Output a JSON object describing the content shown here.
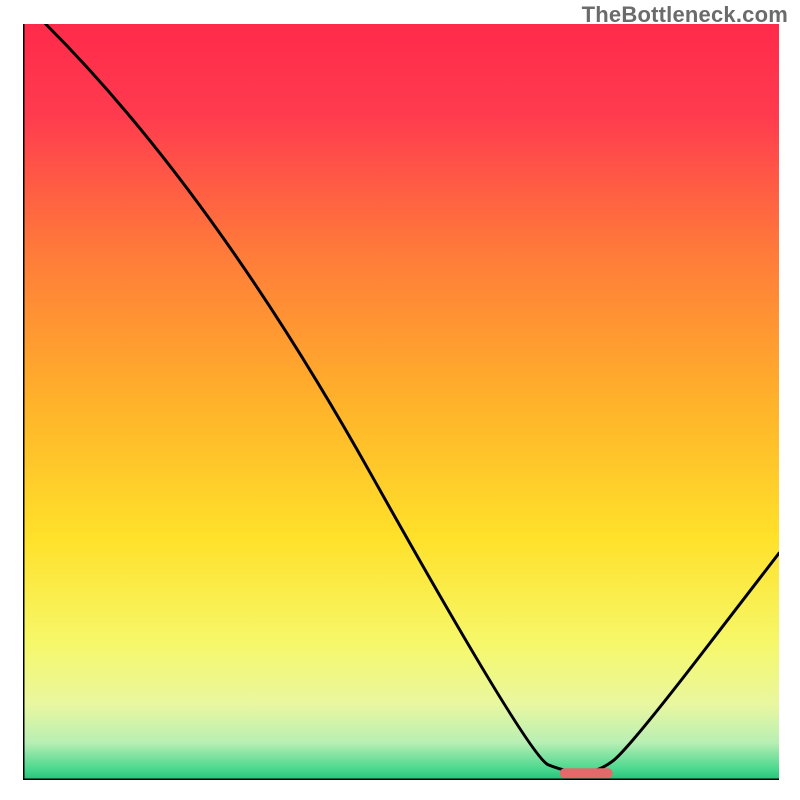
{
  "watermark": "TheBottleneck.com",
  "chart_data": {
    "type": "line",
    "title": "",
    "xlabel": "",
    "ylabel": "",
    "xlim": [
      0,
      100
    ],
    "ylim": [
      0,
      100
    ],
    "grid": false,
    "legend": false,
    "series": [
      {
        "name": "bottleneck-curve",
        "x": [
          3,
          25,
          67,
          72,
          76,
          80,
          100
        ],
        "values": [
          100,
          78,
          3,
          1,
          1,
          4,
          30
        ]
      }
    ],
    "marker": {
      "name": "optimal-range",
      "x_start": 71,
      "x_end": 78,
      "y": 0.9,
      "color": "#e26a6b"
    },
    "background_gradient_stops": [
      {
        "pct": 0.0,
        "color": "#ff2a4a"
      },
      {
        "pct": 12.0,
        "color": "#ff3b4f"
      },
      {
        "pct": 30.0,
        "color": "#ff7a3a"
      },
      {
        "pct": 50.0,
        "color": "#ffb22a"
      },
      {
        "pct": 68.0,
        "color": "#ffe12a"
      },
      {
        "pct": 82.0,
        "color": "#f6f86a"
      },
      {
        "pct": 90.0,
        "color": "#e9f7a0"
      },
      {
        "pct": 95.0,
        "color": "#b9efb4"
      },
      {
        "pct": 98.5,
        "color": "#4cd88f"
      },
      {
        "pct": 100.0,
        "color": "#23c27a"
      }
    ],
    "axis_thickness_px": 3,
    "curve_thickness_px": 3,
    "inner_size_px": 756
  }
}
